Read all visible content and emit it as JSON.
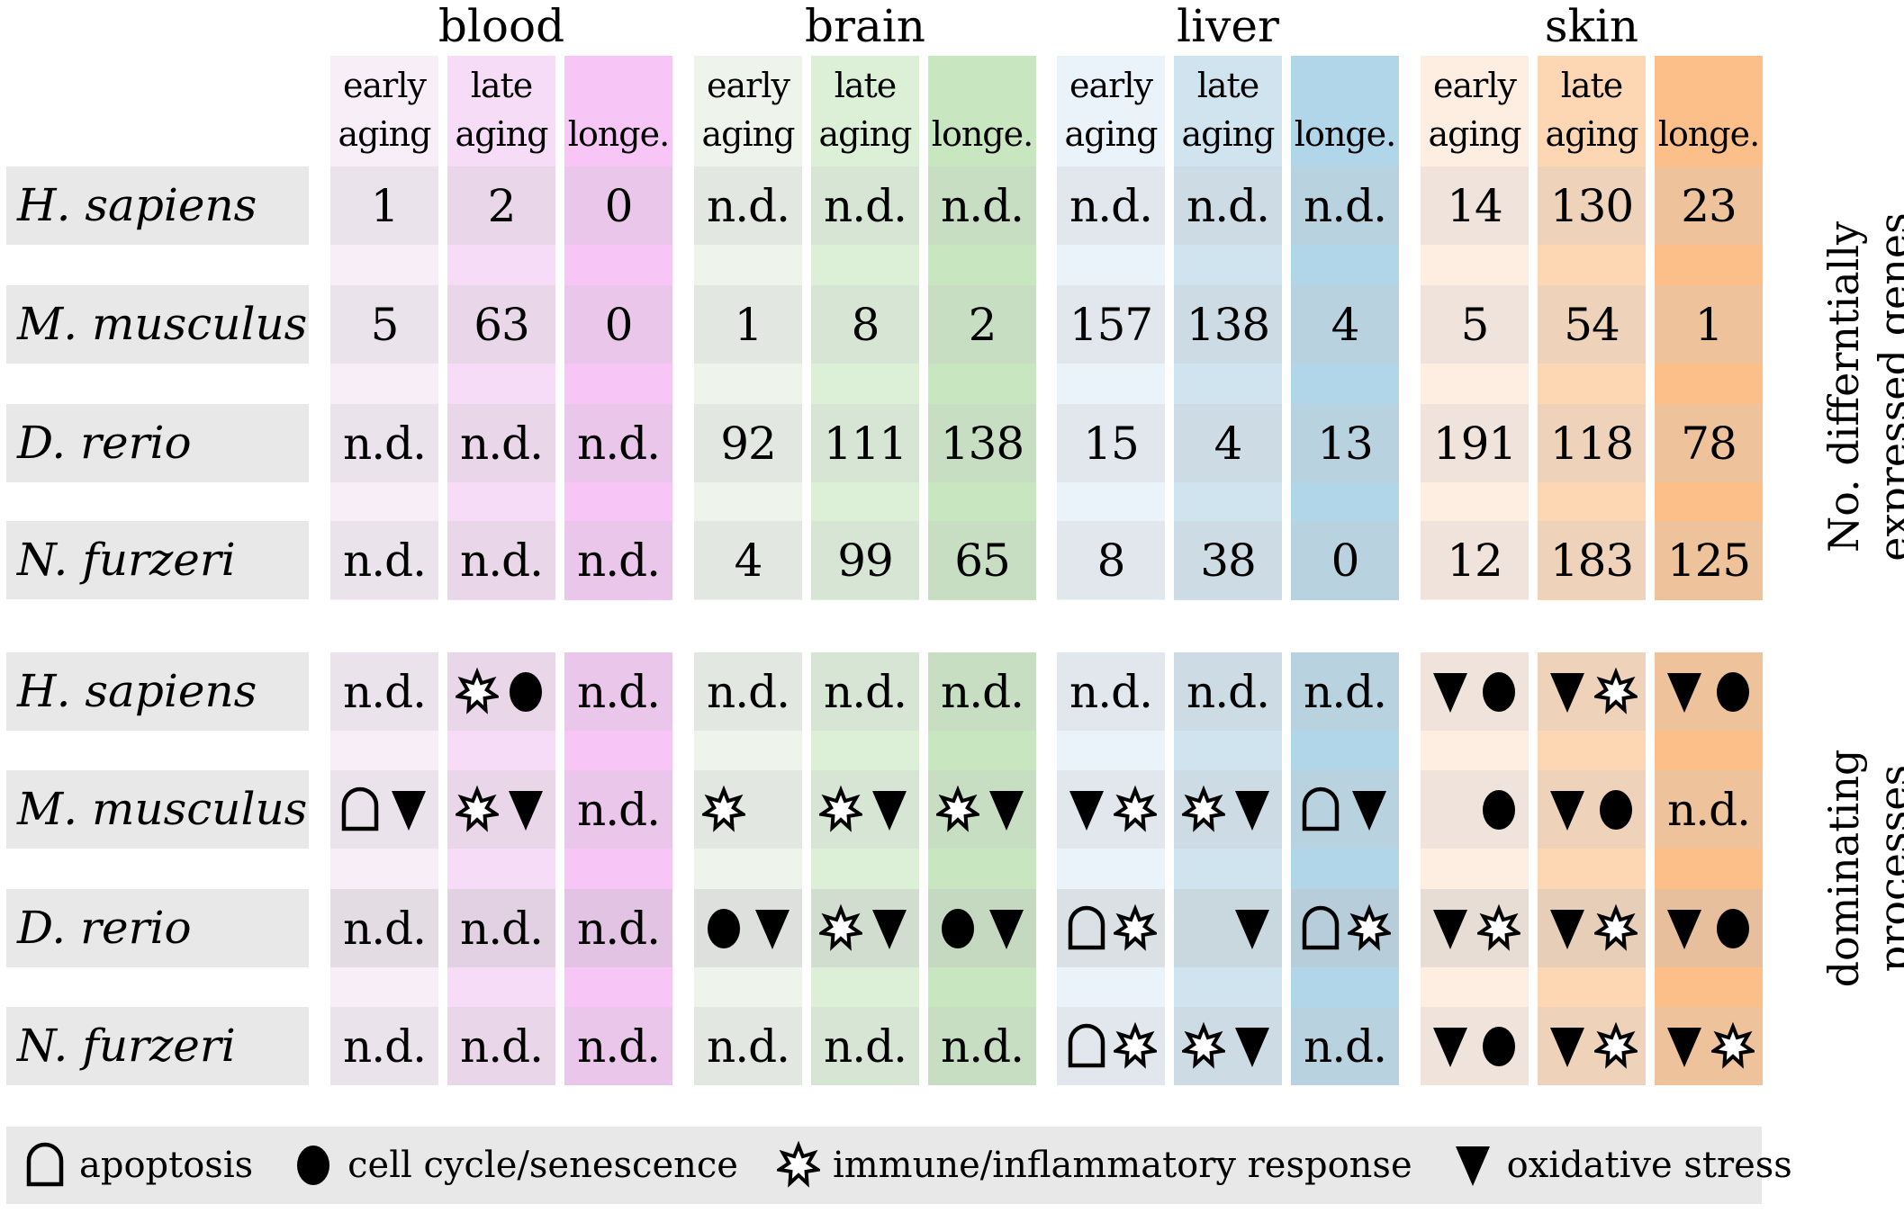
{
  "tissues": [
    {
      "name": "blood",
      "colors": [
        "#f8eef8",
        "#f6dcf6",
        "#f7c6f7"
      ]
    },
    {
      "name": "brain",
      "colors": [
        "#eef3ec",
        "#dcf0d8",
        "#c8e6c0"
      ]
    },
    {
      "name": "liver",
      "colors": [
        "#ebf3fa",
        "#cfe4ef",
        "#b2d6e9"
      ]
    },
    {
      "name": "skin",
      "colors": [
        "#feeee2",
        "#fdd6b4",
        "#fdbf8a"
      ]
    }
  ],
  "column_headers": [
    {
      "line1": "early",
      "line2": "aging"
    },
    {
      "line1": "late",
      "line2": "aging"
    },
    {
      "line1": "",
      "line2": "longe."
    }
  ],
  "species": [
    "H. sapiens",
    "M. musculus",
    "D. rerio",
    "N. furzeri"
  ],
  "section_labels": {
    "genes": [
      "No. differntially",
      "expressed genes"
    ],
    "processes": [
      "dominating",
      "processes"
    ]
  },
  "gene_counts": [
    [
      "1",
      "2",
      "0",
      "n.d.",
      "n.d.",
      "n.d.",
      "n.d.",
      "n.d.",
      "n.d.",
      "14",
      "130",
      "23"
    ],
    [
      "5",
      "63",
      "0",
      "1",
      "8",
      "2",
      "157",
      "138",
      "4",
      "5",
      "54",
      "1"
    ],
    [
      "n.d.",
      "n.d.",
      "n.d.",
      "92",
      "111",
      "138",
      "15",
      "4",
      "13",
      "191",
      "118",
      "78"
    ],
    [
      "n.d.",
      "n.d.",
      "n.d.",
      "4",
      "99",
      "65",
      "8",
      "38",
      "0",
      "12",
      "183",
      "125"
    ]
  ],
  "processes": [
    [
      [
        "n.d."
      ],
      [
        "immune",
        "cellcycle"
      ],
      [
        "n.d."
      ],
      [
        "n.d."
      ],
      [
        "n.d."
      ],
      [
        "n.d."
      ],
      [
        "n.d."
      ],
      [
        "n.d."
      ],
      [
        "n.d."
      ],
      [
        "oxidative",
        "cellcycle"
      ],
      [
        "oxidative",
        "immune"
      ],
      [
        "oxidative",
        "cellcycle"
      ]
    ],
    [
      [
        "apoptosis",
        "oxidative"
      ],
      [
        "immune",
        "oxidative"
      ],
      [
        "n.d."
      ],
      [
        "immune",
        ""
      ],
      [
        "immune",
        "oxidative"
      ],
      [
        "immune",
        "oxidative"
      ],
      [
        "oxidative",
        "immune"
      ],
      [
        "immune",
        "oxidative"
      ],
      [
        "apoptosis",
        "oxidative"
      ],
      [
        "",
        "cellcycle"
      ],
      [
        "oxidative",
        "cellcycle"
      ],
      [
        "n.d."
      ]
    ],
    [
      [
        "n.d."
      ],
      [
        "n.d."
      ],
      [
        "n.d."
      ],
      [
        "cellcycle",
        "oxidative"
      ],
      [
        "immune",
        "oxidative"
      ],
      [
        "cellcycle",
        "oxidative"
      ],
      [
        "apoptosis",
        "immune"
      ],
      [
        "",
        "oxidative"
      ],
      [
        "apoptosis",
        "immune"
      ],
      [
        "oxidative",
        "immune"
      ],
      [
        "oxidative",
        "immune"
      ],
      [
        "oxidative",
        "cellcycle"
      ]
    ],
    [
      [
        "n.d."
      ],
      [
        "n.d."
      ],
      [
        "n.d."
      ],
      [
        "n.d."
      ],
      [
        "n.d."
      ],
      [
        "n.d."
      ],
      [
        "apoptosis",
        "immune"
      ],
      [
        "immune",
        "oxidative"
      ],
      [
        "n.d."
      ],
      [
        "oxidative",
        "cellcycle"
      ],
      [
        "oxidative",
        "immune"
      ],
      [
        "oxidative",
        "immune"
      ]
    ]
  ],
  "legend": [
    {
      "icon": "apoptosis",
      "label": "apoptosis"
    },
    {
      "icon": "cellcycle",
      "label": "cell cycle/senescence"
    },
    {
      "icon": "immune",
      "label": "immune/inflammatory response"
    },
    {
      "icon": "oxidative",
      "label": "oxidative stress"
    }
  ]
}
